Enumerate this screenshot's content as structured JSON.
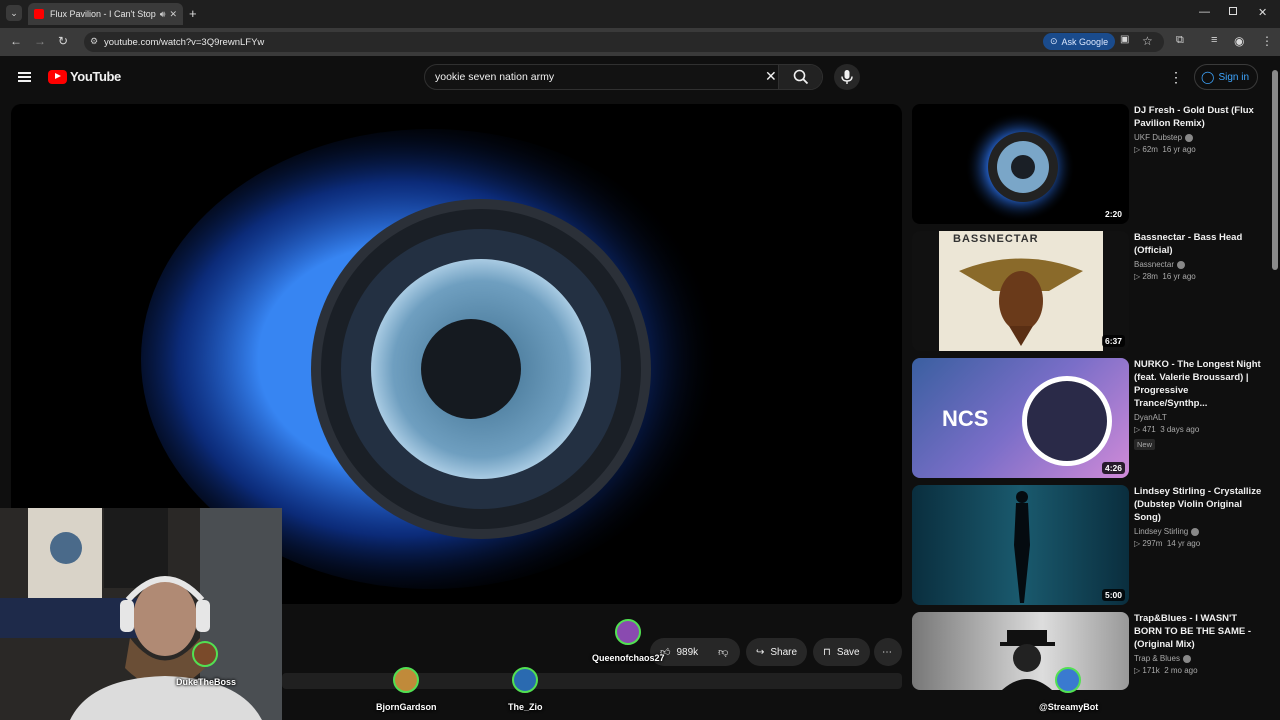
{
  "browser": {
    "tab_title": "Flux Pavilion - I Can't Stop",
    "url": "youtube.com/watch?v=3Q9rewnLFYw",
    "ask_google": "Ask Google"
  },
  "youtube": {
    "logo_text": "YouTube",
    "search_query": "yookie seven nation army",
    "sign_in": "Sign in",
    "likes": "989k",
    "share": "Share",
    "save": "Save"
  },
  "recommendations": [
    {
      "title": "DJ Fresh - Gold Dust (Flux Pavilion Remix)",
      "channel": "UKF Dubstep",
      "views": "62m",
      "age": "16 yr ago",
      "duration": "2:20",
      "verified": true
    },
    {
      "title": "Bassnectar - Bass Head (Official)",
      "channel": "Bassnectar",
      "views": "28m",
      "age": "16 yr ago",
      "duration": "6:37",
      "verified": true
    },
    {
      "title": "NURKO - The Longest Night (feat. Valerie Broussard) | Progressive Trance/Synthp...",
      "channel": "DyanALT",
      "views": "471",
      "age": "3 days ago",
      "duration": "4:26",
      "badge": "New",
      "verified": false
    },
    {
      "title": "Lindsey Stirling - Crystallize (Dubstep Violin Original Song)",
      "channel": "Lindsey Stirling",
      "views": "297m",
      "age": "14 yr ago",
      "duration": "5:00",
      "verified": true
    },
    {
      "title": "Trap&Blues - I WASN'T BORN TO BE THE SAME - (Original Mix)",
      "channel": "Trap & Blues",
      "views": "171k",
      "age": "2 mo ago",
      "duration": "",
      "verified": true
    }
  ],
  "thumb_labels": {
    "ncs": "NCS",
    "bassnectar": "BASSNECTAR"
  },
  "viewers": [
    "DukeTheBoss",
    "Queenofchaos27",
    "BjornGardson",
    "The_Zio",
    "@StreamyBot"
  ],
  "colors": {
    "bg": "#0f0f0f",
    "accent_red": "#ff0000",
    "link_blue": "#3ea6ff",
    "avatar_ring": "#52e052"
  }
}
